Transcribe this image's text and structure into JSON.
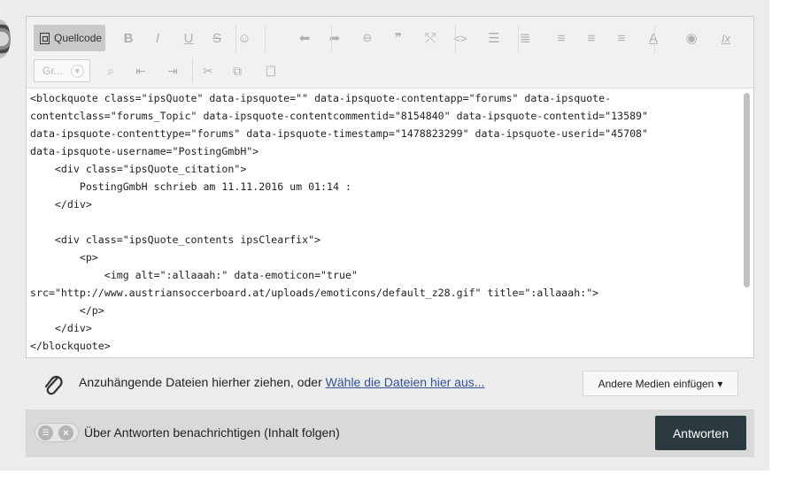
{
  "toolbar": {
    "source_label": "Quellcode",
    "row1": [
      {
        "name": "bold-button",
        "glyph": "B"
      },
      {
        "name": "italic-button",
        "glyph": "I"
      },
      {
        "name": "underline-button",
        "glyph": "U"
      },
      {
        "name": "strikethrough-button",
        "glyph": "S"
      },
      {
        "name": "emoji-button",
        "glyph": "☺"
      },
      {
        "name": "undo-button",
        "glyph": "⬅"
      },
      {
        "name": "redo-button",
        "glyph": "➦"
      },
      {
        "name": "link-button",
        "glyph": "⊖"
      },
      {
        "name": "quote-button",
        "glyph": "❞"
      },
      {
        "name": "unlink-button",
        "glyph": "⤲"
      },
      {
        "name": "code-button",
        "glyph": "<>"
      },
      {
        "name": "bullet-list-button",
        "glyph": "☰"
      },
      {
        "name": "numbered-list-button",
        "glyph": "≣"
      },
      {
        "name": "align-left-button",
        "glyph": "≡"
      },
      {
        "name": "align-center-button",
        "glyph": "≡"
      },
      {
        "name": "align-right-button",
        "glyph": "≡"
      },
      {
        "name": "text-color-button",
        "glyph": "A"
      },
      {
        "name": "preview-button",
        "glyph": "◉"
      },
      {
        "name": "remove-format-button",
        "glyph": "Ix"
      }
    ],
    "size_combo_label": "Gr...",
    "row2": [
      {
        "name": "find-button",
        "glyph": "⌕"
      },
      {
        "name": "indent-decrease-button",
        "glyph": "⇤"
      },
      {
        "name": "indent-increase-button",
        "glyph": "⇥"
      },
      {
        "name": "cut-button",
        "glyph": "✂"
      },
      {
        "name": "copy-button",
        "glyph": "⧉"
      },
      {
        "name": "paste-button",
        "glyph": "📋"
      }
    ]
  },
  "editor": {
    "source_lines": [
      "<blockquote class=\"ipsQuote\" data-ipsquote=\"\" data-ipsquote-contentapp=\"forums\" data-ipsquote-",
      "contentclass=\"forums_Topic\" data-ipsquote-contentcommentid=\"8154840\" data-ipsquote-contentid=\"13589\"",
      "data-ipsquote-contenttype=\"forums\" data-ipsquote-timestamp=\"1478823299\" data-ipsquote-userid=\"45708\"",
      "data-ipsquote-username=\"PostingGmbH\">",
      "    <div class=\"ipsQuote_citation\">",
      "        PostingGmbH schrieb am 11.11.2016 um 01:14 :",
      "    </div>",
      "",
      "    <div class=\"ipsQuote_contents ipsClearfix\">",
      "        <p>",
      "            <img alt=\":allaaah:\" data-emoticon=\"true\"",
      "src=\"http://www.austriansoccerboard.at/uploads/emoticons/default_z28.gif\" title=\":allaaah:\">",
      "        </p>",
      "    </div>",
      "</blockquote>"
    ]
  },
  "attachments": {
    "prompt_text": "Anzuhängende Dateien hierher ziehen, oder ",
    "choose_link": "Wähle die Dateien hier aus...",
    "media_button": "Andere Medien einfügen",
    "media_caret": "▾"
  },
  "footer": {
    "follow_label": "Über Antworten benachrichtigen (Inhalt folgen)",
    "reply_button": "Antworten"
  },
  "colors": {
    "reply_button_bg": "#2b3a3f",
    "link_color": "#2f5597",
    "toolbar_bg": "#f1f1f1"
  }
}
